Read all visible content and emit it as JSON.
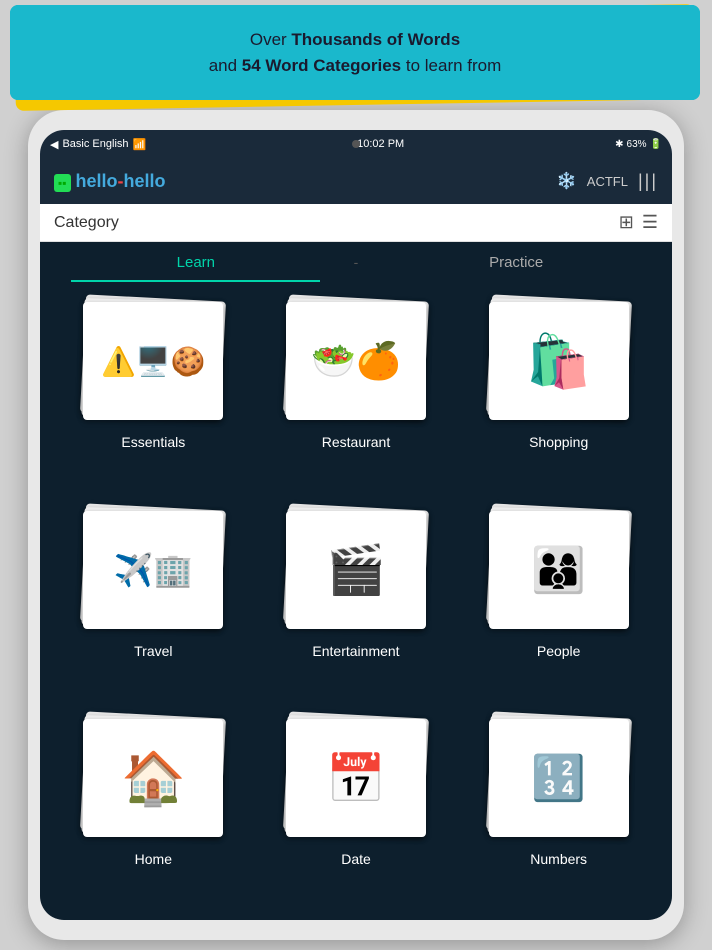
{
  "banner": {
    "line1_normal": "Over ",
    "line1_bold": "Thousands of Words",
    "line2_normal": "and ",
    "line2_bold": "54 Word Categories",
    "line2_end": " to learn from"
  },
  "status_bar": {
    "carrier": "Basic English",
    "wifi_icon": "wifi",
    "time": "10:02 PM",
    "bluetooth_icon": "bluetooth",
    "battery": "63%"
  },
  "app_header": {
    "logo": "hello-hello",
    "actfl_label": "ACTFL",
    "menu_icon": "menu"
  },
  "category_bar": {
    "title": "Category",
    "grid_icon": "grid",
    "list_icon": "list"
  },
  "tabs": {
    "learn": "Learn",
    "divider": "-",
    "practice": "Practice"
  },
  "categories": [
    {
      "id": "essentials",
      "label": "Essentials",
      "icon": "essentials"
    },
    {
      "id": "restaurant",
      "label": "Restaurant",
      "icon": "restaurant"
    },
    {
      "id": "shopping",
      "label": "Shopping",
      "icon": "shopping"
    },
    {
      "id": "travel",
      "label": "Travel",
      "icon": "travel"
    },
    {
      "id": "entertainment",
      "label": "Entertainment",
      "icon": "entertainment"
    },
    {
      "id": "people",
      "label": "People",
      "icon": "people"
    },
    {
      "id": "home",
      "label": "Home",
      "icon": "home"
    },
    {
      "id": "date",
      "label": "Date",
      "icon": "date"
    },
    {
      "id": "numbers",
      "label": "Numbers",
      "icon": "numbers"
    }
  ]
}
